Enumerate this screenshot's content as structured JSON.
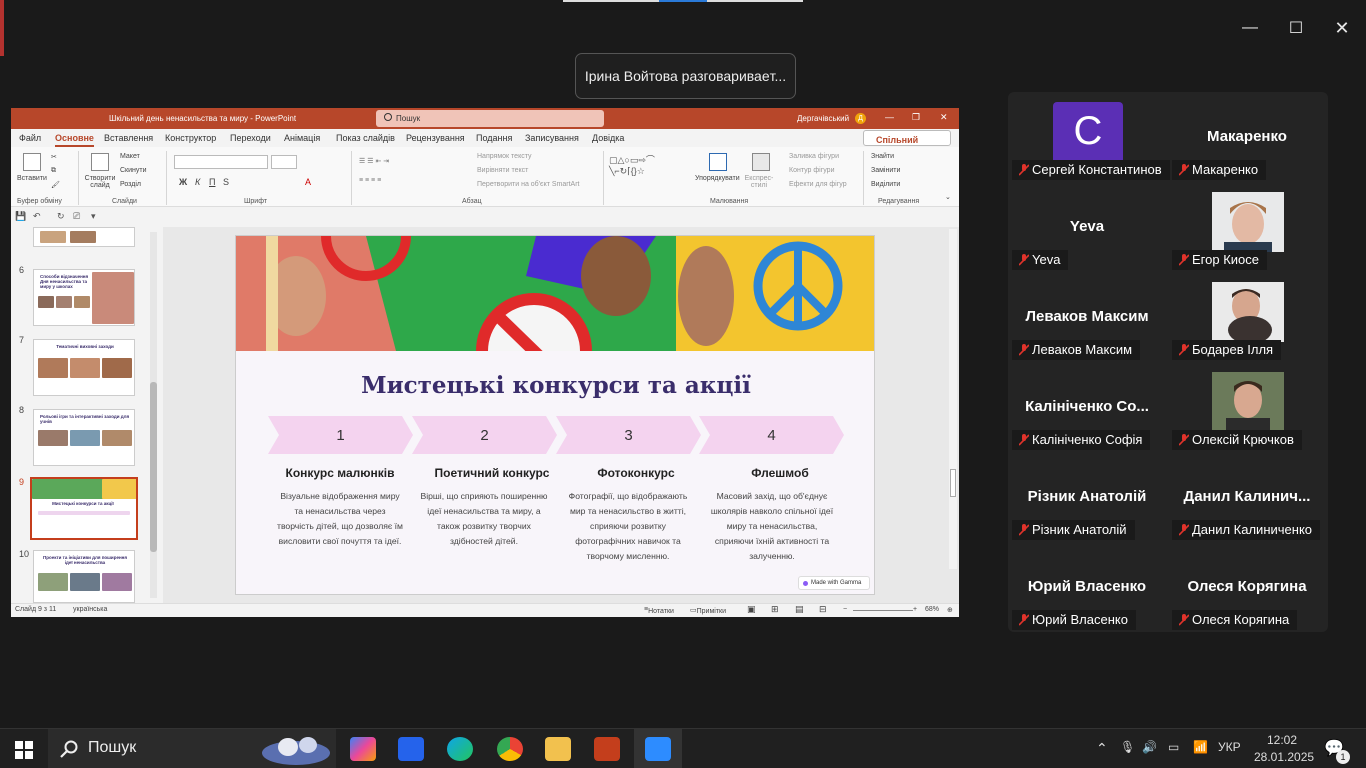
{
  "zoom": {
    "speaker_banner": "Ірина Войтова разговариваeт...",
    "window_controls": {
      "minimize": "—",
      "maximize": "☐",
      "close": "✕"
    }
  },
  "ppt": {
    "title": "Шкільний день ненасильства та миру - PowerPoint",
    "search_placeholder": "Пошук",
    "user": "Дергачівський",
    "user_initial": "Д",
    "tabs": [
      "Файл",
      "Основне",
      "Вставлення",
      "Конструктор",
      "Переходи",
      "Анімація",
      "Показ слайдів",
      "Рецензування",
      "Подання",
      "Записування",
      "Довідка"
    ],
    "share": "Спільний доступ",
    "ribbon": {
      "paste": "Вставити",
      "clipboard_group": "Буфер обміну",
      "new_slide": "Створити слайд",
      "layout": "Макет",
      "reset": "Скинути",
      "section": "Розділ",
      "slides_group": "Слайди",
      "font_group": "Шрифт",
      "text_direction": "Напрямок тексту",
      "align_text": "Вирівняти текст",
      "smartart": "Перетворити на об'єкт SmartArt",
      "paragraph_group": "Абзац",
      "arrange": "Упорядкувати",
      "quick_styles": "Експрес-стилі",
      "shape_fill": "Заливка фігури",
      "shape_outline": "Контур фігури",
      "shape_effects": "Ефекти для фігур",
      "drawing_group": "Малювання",
      "find": "Знайти",
      "replace": "Замінити",
      "select": "Виділити",
      "editing_group": "Редагування",
      "bold": "Ж",
      "italic": "К",
      "underline": "П",
      "strike": "S",
      "fontcolor": "A"
    },
    "thumbs": [
      {
        "num": "6",
        "title": "Способи відзначення Дня ненасильства та миру у школах"
      },
      {
        "num": "7",
        "title": "Тематичні виховні заходи"
      },
      {
        "num": "8",
        "title": "Рольові ігри та інтерактивні заходи для учнів"
      },
      {
        "num": "9",
        "title": "Мистецькі конкурси та акції"
      },
      {
        "num": "10",
        "title": "Проекти та ініціативи для поширення ідеї ненасильства"
      }
    ],
    "slide": {
      "title": "Мистецькі конкурси та акції",
      "steps": [
        {
          "num": "1",
          "title": "Конкурс малюнків",
          "desc": "Візуальне відображення миру та ненасильства через творчість дітей, що дозволяє їм висловити свої почуття та ідеї."
        },
        {
          "num": "2",
          "title": "Поетичний конкурс",
          "desc": "Вірші, що сприяють поширенню ідеї ненасильства та миру, а також розвитку творчих здібностей дітей."
        },
        {
          "num": "3",
          "title": "Фотоконкурс",
          "desc": "Фотографії, що відображають мир та ненасильство в житті, сприяючи розвитку фотографічних навичок та творчому мисленню."
        },
        {
          "num": "4",
          "title": "Флешмоб",
          "desc": "Масовий захід, що об'єднує школярів навколо спільної ідеї миру та ненасильства, сприяючи їхній активності та залученню."
        }
      ],
      "badge": "Made with Gamma"
    },
    "status": {
      "slide_of": "Слайд 9 з 11",
      "language": "українська",
      "notes": "Нотатки",
      "comments": "Примітки",
      "zoom": "68%"
    }
  },
  "participants": [
    {
      "display": "C",
      "label": "Сергей Константинов",
      "type": "avatar"
    },
    {
      "display": "Макаренко",
      "label": "Макаренко",
      "type": "name"
    },
    {
      "display": "Yeva",
      "label": "Yeva",
      "type": "name"
    },
    {
      "display": "",
      "label": "Егор Киосе",
      "type": "video"
    },
    {
      "display": "Леваков Максим",
      "label": "Леваков Максим",
      "type": "name"
    },
    {
      "display": "",
      "label": "Бодарев Ілля",
      "type": "video"
    },
    {
      "display": "Калініченко Со...",
      "label": "Калініченко Софія",
      "type": "name"
    },
    {
      "display": "",
      "label": "Олексій Крючков",
      "type": "video"
    },
    {
      "display": "Різник Анатолій",
      "label": "Різник Анатолій",
      "type": "name"
    },
    {
      "display": "Данил  Калинич...",
      "label": "Данил Калиниченко",
      "type": "name"
    },
    {
      "display": "Юрий Власенко",
      "label": "Юрий Власенко",
      "type": "name"
    },
    {
      "display": "Олеся Корягина",
      "label": "Олеся Корягина",
      "type": "name"
    }
  ],
  "taskbar": {
    "search": "Пошук",
    "lang": "УКР",
    "time": "12:02",
    "date": "28.01.2025",
    "notifications": "1"
  }
}
